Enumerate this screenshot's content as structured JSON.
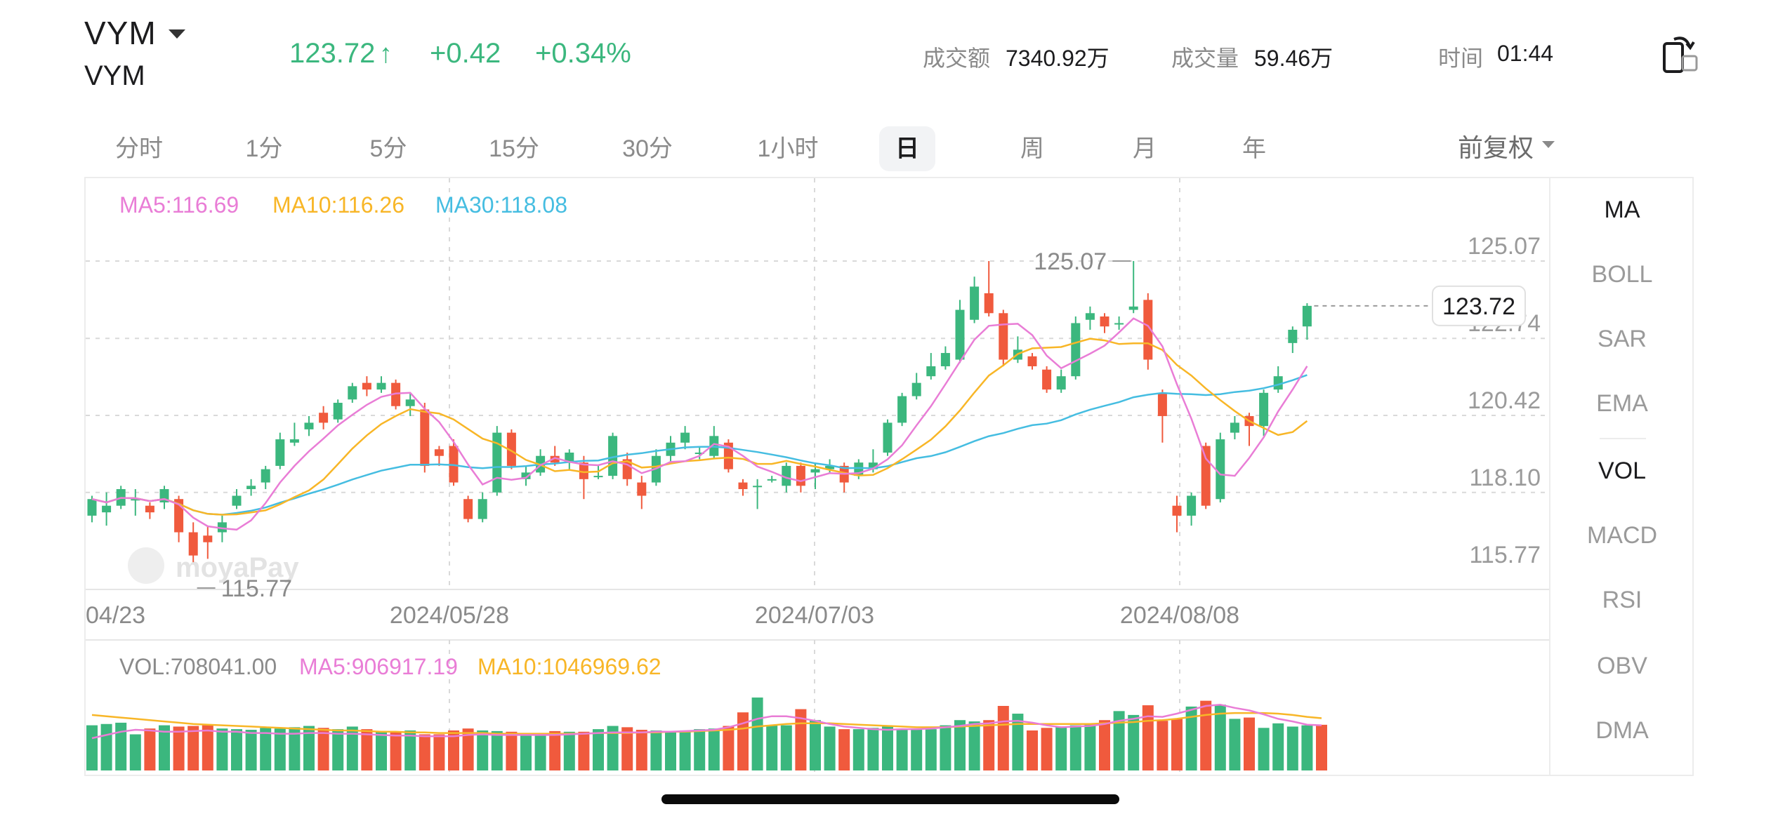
{
  "header": {
    "symbol": "VYM",
    "symbol_sub": "VYM",
    "price": "123.72",
    "price_arrow": "↑",
    "change": "+0.42",
    "change_pct": "+0.34%",
    "turnover_label": "成交额",
    "turnover_value": "7340.92万",
    "volume_label": "成交量",
    "volume_value": "59.46万",
    "time_label": "时间",
    "time_value": "01:44"
  },
  "period_tabs": [
    "分时",
    "1分",
    "5分",
    "15分",
    "30分",
    "1小时",
    "日",
    "周",
    "月",
    "年"
  ],
  "active_tab": "日",
  "adjust_label": "前复权",
  "colors": {
    "up": "#3bb77e",
    "down": "#f05a3d",
    "ma5": "#e97dd6",
    "ma10": "#f8b627",
    "ma30": "#45bde1"
  },
  "ma_legend": {
    "ma5": "MA5:116.69",
    "ma10": "MA10:116.26",
    "ma30": "MA30:118.08"
  },
  "vol_legend": {
    "vol": "VOL:708041.00",
    "ma5": "MA5:906917.19",
    "ma10": "MA10:1046969.62"
  },
  "indicator_tabs": [
    "MA",
    "BOLL",
    "SAR",
    "EMA",
    "VOL",
    "MACD",
    "RSI",
    "OBV",
    "DMA"
  ],
  "indicator_active": [
    "MA",
    "VOL"
  ],
  "watermark": "moyaPay",
  "chart_data": {
    "type": "candlestick",
    "y_ticks": [
      "125.07",
      "122.74",
      "120.42",
      "118.10",
      "115.77"
    ],
    "ylim": [
      115.77,
      125.07
    ],
    "x_labels": [
      "04/23",
      "2024/05/28",
      "2024/07/03",
      "2024/08/08"
    ],
    "high_label": "125.07",
    "low_label": "115.77",
    "last_price_tag": "123.72",
    "candles": [
      [
        117.4,
        117.9,
        117.2,
        118.0
      ],
      [
        117.5,
        117.7,
        117.1,
        118.1
      ],
      [
        117.7,
        118.2,
        117.6,
        118.3
      ],
      [
        117.9,
        117.9,
        117.4,
        118.2
      ],
      [
        117.7,
        117.5,
        117.3,
        117.8
      ],
      [
        117.8,
        118.2,
        117.6,
        118.3
      ],
      [
        117.9,
        116.9,
        116.6,
        118.0
      ],
      [
        116.9,
        116.2,
        116.0,
        117.2
      ],
      [
        116.8,
        116.6,
        116.1,
        117.1
      ],
      [
        116.9,
        117.2,
        116.6,
        117.4
      ],
      [
        117.7,
        118.0,
        117.6,
        118.2
      ],
      [
        118.2,
        118.3,
        118.0,
        118.5
      ],
      [
        118.4,
        118.8,
        118.2,
        118.9
      ],
      [
        118.9,
        119.7,
        118.8,
        119.9
      ],
      [
        119.6,
        119.7,
        119.5,
        120.2
      ],
      [
        120.0,
        120.2,
        119.8,
        120.4
      ],
      [
        120.5,
        120.2,
        120.0,
        120.7
      ],
      [
        120.3,
        120.8,
        120.2,
        120.9
      ],
      [
        120.9,
        121.3,
        120.8,
        121.4
      ],
      [
        121.4,
        121.2,
        121.0,
        121.6
      ],
      [
        121.2,
        121.4,
        121.1,
        121.6
      ],
      [
        121.4,
        120.7,
        120.6,
        121.5
      ],
      [
        120.7,
        120.9,
        120.4,
        121.1
      ],
      [
        120.6,
        118.9,
        118.7,
        120.8
      ],
      [
        119.4,
        119.2,
        118.9,
        119.5
      ],
      [
        119.5,
        118.4,
        118.3,
        119.7
      ],
      [
        117.9,
        117.3,
        117.2,
        118.0
      ],
      [
        117.3,
        117.9,
        117.2,
        118.1
      ],
      [
        118.1,
        119.9,
        118.0,
        120.1
      ],
      [
        119.9,
        118.9,
        118.8,
        120.0
      ],
      [
        118.5,
        118.7,
        118.3,
        118.9
      ],
      [
        118.7,
        119.2,
        118.6,
        119.4
      ],
      [
        119.2,
        119.0,
        118.9,
        119.5
      ],
      [
        119.0,
        119.3,
        118.8,
        119.4
      ],
      [
        119.0,
        118.5,
        117.9,
        119.2
      ],
      [
        118.6,
        118.6,
        118.5,
        118.9
      ],
      [
        118.6,
        119.8,
        118.5,
        119.9
      ],
      [
        119.1,
        118.5,
        118.3,
        119.3
      ],
      [
        118.4,
        118.0,
        117.6,
        118.6
      ],
      [
        118.4,
        119.2,
        118.3,
        119.4
      ],
      [
        119.2,
        119.6,
        119.0,
        119.8
      ],
      [
        119.6,
        119.9,
        119.4,
        120.1
      ],
      [
        119.3,
        119.3,
        119.1,
        119.5
      ],
      [
        119.2,
        119.8,
        119.1,
        120.1
      ],
      [
        119.6,
        118.8,
        118.7,
        119.7
      ],
      [
        118.4,
        118.2,
        118.0,
        118.5
      ],
      [
        118.3,
        118.3,
        117.6,
        118.5
      ],
      [
        118.5,
        118.5,
        118.4,
        118.6
      ],
      [
        118.3,
        118.9,
        118.1,
        119.0
      ],
      [
        118.9,
        118.3,
        118.1,
        119.0
      ],
      [
        118.7,
        118.8,
        118.2,
        119.0
      ],
      [
        118.8,
        118.9,
        118.7,
        119.1
      ],
      [
        118.9,
        118.4,
        118.1,
        119.0
      ],
      [
        118.6,
        119.0,
        118.5,
        119.1
      ],
      [
        118.8,
        119.0,
        118.7,
        119.4
      ],
      [
        119.3,
        120.2,
        119.2,
        120.3
      ],
      [
        120.2,
        121.0,
        120.1,
        121.1
      ],
      [
        121.0,
        121.4,
        120.9,
        121.7
      ],
      [
        121.6,
        121.9,
        121.5,
        122.3
      ],
      [
        121.9,
        122.3,
        121.8,
        122.5
      ],
      [
        122.1,
        123.6,
        122.0,
        123.9
      ],
      [
        123.3,
        124.3,
        123.2,
        124.6
      ],
      [
        124.1,
        123.5,
        123.4,
        125.07
      ],
      [
        123.5,
        122.1,
        121.9,
        123.6
      ],
      [
        122.1,
        122.4,
        122.0,
        122.8
      ],
      [
        122.2,
        121.9,
        121.8,
        122.3
      ],
      [
        121.8,
        121.2,
        121.1,
        121.9
      ],
      [
        121.2,
        121.6,
        121.1,
        121.8
      ],
      [
        121.6,
        123.2,
        121.5,
        123.4
      ],
      [
        123.3,
        123.5,
        123.0,
        123.7
      ],
      [
        123.4,
        123.1,
        122.9,
        123.5
      ],
      [
        123.2,
        123.2,
        123.0,
        123.4
      ],
      [
        123.6,
        123.7,
        123.5,
        125.07
      ],
      [
        123.9,
        122.1,
        121.8,
        124.1
      ],
      [
        121.1,
        120.4,
        119.6,
        121.2
      ],
      [
        117.7,
        117.4,
        116.9,
        118.0
      ],
      [
        117.4,
        118.0,
        117.1,
        118.1
      ],
      [
        119.5,
        117.7,
        117.6,
        119.6
      ],
      [
        117.9,
        119.7,
        117.8,
        119.9
      ],
      [
        119.9,
        120.2,
        119.7,
        120.4
      ],
      [
        120.4,
        120.1,
        119.5,
        120.5
      ],
      [
        120.1,
        121.1,
        119.8,
        121.2
      ],
      [
        121.2,
        121.6,
        121.1,
        121.9
      ],
      [
        122.6,
        123.0,
        122.3,
        123.1
      ],
      [
        123.1,
        123.72,
        122.7,
        123.8
      ]
    ],
    "volume": {
      "ylim": [
        0,
        2000000
      ],
      "values": [
        700000,
        720000,
        740000,
        560000,
        650000,
        700000,
        680000,
        690000,
        700000,
        650000,
        640000,
        630000,
        660000,
        650000,
        670000,
        690000,
        660000,
        640000,
        680000,
        640000,
        600000,
        600000,
        620000,
        560000,
        560000,
        620000,
        650000,
        620000,
        610000,
        600000,
        580000,
        560000,
        610000,
        600000,
        600000,
        640000,
        690000,
        670000,
        630000,
        620000,
        600000,
        620000,
        640000,
        650000,
        690000,
        900000,
        1130000,
        700000,
        700000,
        950000,
        780000,
        680000,
        640000,
        640000,
        660000,
        680000,
        640000,
        650000,
        640000,
        700000,
        780000,
        760000,
        780000,
        1000000,
        880000,
        620000,
        660000,
        680000,
        700000,
        720000,
        780000,
        920000,
        860000,
        1010000,
        770000,
        800000,
        990000,
        1080000,
        1020000,
        800000,
        820000,
        660000,
        730000,
        680000,
        700000,
        708041
      ],
      "ma5": [
        0.5,
        0.55,
        0.6,
        0.63,
        0.62,
        0.6,
        0.6,
        0.61,
        0.62,
        0.6,
        0.6,
        0.58,
        0.58,
        0.57,
        0.57,
        0.58,
        0.58,
        0.57,
        0.57,
        0.56,
        0.55,
        0.54,
        0.54,
        0.53,
        0.53,
        0.53,
        0.55,
        0.56,
        0.55,
        0.55,
        0.55,
        0.55,
        0.55,
        0.56,
        0.57,
        0.58,
        0.59,
        0.59,
        0.59,
        0.6,
        0.6,
        0.61,
        0.62,
        0.63,
        0.67,
        0.73,
        0.8,
        0.84,
        0.84,
        0.81,
        0.77,
        0.72,
        0.68,
        0.66,
        0.64,
        0.63,
        0.64,
        0.64,
        0.65,
        0.67,
        0.69,
        0.72,
        0.73,
        0.76,
        0.77,
        0.74,
        0.7,
        0.67,
        0.68,
        0.69,
        0.72,
        0.77,
        0.8,
        0.84,
        0.83,
        0.88,
        0.94,
        1.0,
        1.02,
        0.97,
        0.93,
        0.87,
        0.8,
        0.76,
        0.71,
        0.7
      ],
      "ma10": [
        0.86,
        0.84,
        0.82,
        0.8,
        0.78,
        0.76,
        0.74,
        0.72,
        0.71,
        0.7,
        0.69,
        0.68,
        0.67,
        0.66,
        0.65,
        0.64,
        0.63,
        0.62,
        0.62,
        0.61,
        0.6,
        0.6,
        0.59,
        0.59,
        0.58,
        0.58,
        0.58,
        0.58,
        0.57,
        0.57,
        0.57,
        0.57,
        0.57,
        0.57,
        0.57,
        0.58,
        0.58,
        0.58,
        0.59,
        0.59,
        0.6,
        0.6,
        0.61,
        0.62,
        0.63,
        0.65,
        0.68,
        0.7,
        0.72,
        0.73,
        0.73,
        0.73,
        0.72,
        0.71,
        0.7,
        0.69,
        0.68,
        0.67,
        0.67,
        0.67,
        0.68,
        0.69,
        0.7,
        0.71,
        0.72,
        0.72,
        0.72,
        0.72,
        0.72,
        0.72,
        0.73,
        0.74,
        0.75,
        0.77,
        0.78,
        0.8,
        0.83,
        0.86,
        0.88,
        0.89,
        0.89,
        0.89,
        0.88,
        0.86,
        0.83,
        0.81
      ]
    }
  }
}
